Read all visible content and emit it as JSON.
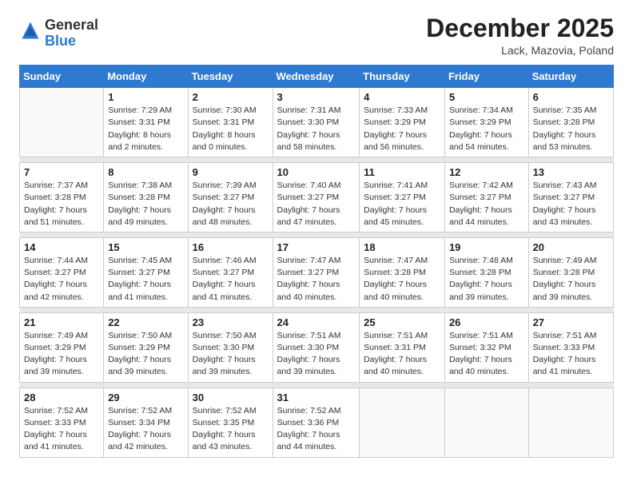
{
  "logo": {
    "general": "General",
    "blue": "Blue"
  },
  "title": "December 2025",
  "location": "Lack, Mazovia, Poland",
  "days_header": [
    "Sunday",
    "Monday",
    "Tuesday",
    "Wednesday",
    "Thursday",
    "Friday",
    "Saturday"
  ],
  "weeks": [
    [
      {
        "num": "",
        "sunrise": "",
        "sunset": "",
        "daylight": ""
      },
      {
        "num": "1",
        "sunrise": "Sunrise: 7:29 AM",
        "sunset": "Sunset: 3:31 PM",
        "daylight": "Daylight: 8 hours and 2 minutes."
      },
      {
        "num": "2",
        "sunrise": "Sunrise: 7:30 AM",
        "sunset": "Sunset: 3:31 PM",
        "daylight": "Daylight: 8 hours and 0 minutes."
      },
      {
        "num": "3",
        "sunrise": "Sunrise: 7:31 AM",
        "sunset": "Sunset: 3:30 PM",
        "daylight": "Daylight: 7 hours and 58 minutes."
      },
      {
        "num": "4",
        "sunrise": "Sunrise: 7:33 AM",
        "sunset": "Sunset: 3:29 PM",
        "daylight": "Daylight: 7 hours and 56 minutes."
      },
      {
        "num": "5",
        "sunrise": "Sunrise: 7:34 AM",
        "sunset": "Sunset: 3:29 PM",
        "daylight": "Daylight: 7 hours and 54 minutes."
      },
      {
        "num": "6",
        "sunrise": "Sunrise: 7:35 AM",
        "sunset": "Sunset: 3:28 PM",
        "daylight": "Daylight: 7 hours and 53 minutes."
      }
    ],
    [
      {
        "num": "7",
        "sunrise": "Sunrise: 7:37 AM",
        "sunset": "Sunset: 3:28 PM",
        "daylight": "Daylight: 7 hours and 51 minutes."
      },
      {
        "num": "8",
        "sunrise": "Sunrise: 7:38 AM",
        "sunset": "Sunset: 3:28 PM",
        "daylight": "Daylight: 7 hours and 49 minutes."
      },
      {
        "num": "9",
        "sunrise": "Sunrise: 7:39 AM",
        "sunset": "Sunset: 3:27 PM",
        "daylight": "Daylight: 7 hours and 48 minutes."
      },
      {
        "num": "10",
        "sunrise": "Sunrise: 7:40 AM",
        "sunset": "Sunset: 3:27 PM",
        "daylight": "Daylight: 7 hours and 47 minutes."
      },
      {
        "num": "11",
        "sunrise": "Sunrise: 7:41 AM",
        "sunset": "Sunset: 3:27 PM",
        "daylight": "Daylight: 7 hours and 45 minutes."
      },
      {
        "num": "12",
        "sunrise": "Sunrise: 7:42 AM",
        "sunset": "Sunset: 3:27 PM",
        "daylight": "Daylight: 7 hours and 44 minutes."
      },
      {
        "num": "13",
        "sunrise": "Sunrise: 7:43 AM",
        "sunset": "Sunset: 3:27 PM",
        "daylight": "Daylight: 7 hours and 43 minutes."
      }
    ],
    [
      {
        "num": "14",
        "sunrise": "Sunrise: 7:44 AM",
        "sunset": "Sunset: 3:27 PM",
        "daylight": "Daylight: 7 hours and 42 minutes."
      },
      {
        "num": "15",
        "sunrise": "Sunrise: 7:45 AM",
        "sunset": "Sunset: 3:27 PM",
        "daylight": "Daylight: 7 hours and 41 minutes."
      },
      {
        "num": "16",
        "sunrise": "Sunrise: 7:46 AM",
        "sunset": "Sunset: 3:27 PM",
        "daylight": "Daylight: 7 hours and 41 minutes."
      },
      {
        "num": "17",
        "sunrise": "Sunrise: 7:47 AM",
        "sunset": "Sunset: 3:27 PM",
        "daylight": "Daylight: 7 hours and 40 minutes."
      },
      {
        "num": "18",
        "sunrise": "Sunrise: 7:47 AM",
        "sunset": "Sunset: 3:28 PM",
        "daylight": "Daylight: 7 hours and 40 minutes."
      },
      {
        "num": "19",
        "sunrise": "Sunrise: 7:48 AM",
        "sunset": "Sunset: 3:28 PM",
        "daylight": "Daylight: 7 hours and 39 minutes."
      },
      {
        "num": "20",
        "sunrise": "Sunrise: 7:49 AM",
        "sunset": "Sunset: 3:28 PM",
        "daylight": "Daylight: 7 hours and 39 minutes."
      }
    ],
    [
      {
        "num": "21",
        "sunrise": "Sunrise: 7:49 AM",
        "sunset": "Sunset: 3:29 PM",
        "daylight": "Daylight: 7 hours and 39 minutes."
      },
      {
        "num": "22",
        "sunrise": "Sunrise: 7:50 AM",
        "sunset": "Sunset: 3:29 PM",
        "daylight": "Daylight: 7 hours and 39 minutes."
      },
      {
        "num": "23",
        "sunrise": "Sunrise: 7:50 AM",
        "sunset": "Sunset: 3:30 PM",
        "daylight": "Daylight: 7 hours and 39 minutes."
      },
      {
        "num": "24",
        "sunrise": "Sunrise: 7:51 AM",
        "sunset": "Sunset: 3:30 PM",
        "daylight": "Daylight: 7 hours and 39 minutes."
      },
      {
        "num": "25",
        "sunrise": "Sunrise: 7:51 AM",
        "sunset": "Sunset: 3:31 PM",
        "daylight": "Daylight: 7 hours and 40 minutes."
      },
      {
        "num": "26",
        "sunrise": "Sunrise: 7:51 AM",
        "sunset": "Sunset: 3:32 PM",
        "daylight": "Daylight: 7 hours and 40 minutes."
      },
      {
        "num": "27",
        "sunrise": "Sunrise: 7:51 AM",
        "sunset": "Sunset: 3:33 PM",
        "daylight": "Daylight: 7 hours and 41 minutes."
      }
    ],
    [
      {
        "num": "28",
        "sunrise": "Sunrise: 7:52 AM",
        "sunset": "Sunset: 3:33 PM",
        "daylight": "Daylight: 7 hours and 41 minutes."
      },
      {
        "num": "29",
        "sunrise": "Sunrise: 7:52 AM",
        "sunset": "Sunset: 3:34 PM",
        "daylight": "Daylight: 7 hours and 42 minutes."
      },
      {
        "num": "30",
        "sunrise": "Sunrise: 7:52 AM",
        "sunset": "Sunset: 3:35 PM",
        "daylight": "Daylight: 7 hours and 43 minutes."
      },
      {
        "num": "31",
        "sunrise": "Sunrise: 7:52 AM",
        "sunset": "Sunset: 3:36 PM",
        "daylight": "Daylight: 7 hours and 44 minutes."
      },
      {
        "num": "",
        "sunrise": "",
        "sunset": "",
        "daylight": ""
      },
      {
        "num": "",
        "sunrise": "",
        "sunset": "",
        "daylight": ""
      },
      {
        "num": "",
        "sunrise": "",
        "sunset": "",
        "daylight": ""
      }
    ]
  ]
}
